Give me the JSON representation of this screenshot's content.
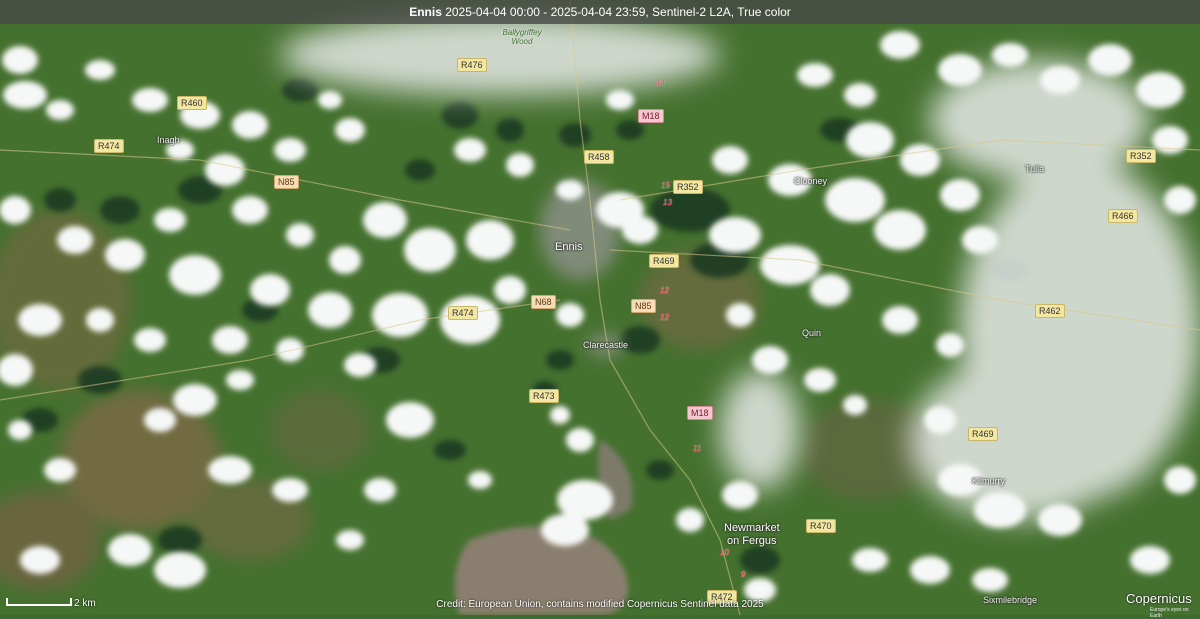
{
  "header": {
    "title_place": "Ennis",
    "title_rest": " 2025-04-04 00:00 - 2025-04-04 23:59, Sentinel-2 L2A, True color"
  },
  "roads": {
    "r476": "R476",
    "r460": "R460",
    "r474a": "R474",
    "m18a": "M18",
    "r458": "R458",
    "r352a": "R352",
    "r352b": "R352",
    "n85a": "N85",
    "r466": "R466",
    "r469a": "R469",
    "n68": "N68",
    "n85b": "N85",
    "r474b": "R474",
    "r462": "R462",
    "r473": "R473",
    "m18b": "M18",
    "r469b": "R469",
    "r470": "R470",
    "r472": "R472"
  },
  "places": {
    "ballygriffey": "Ballygriffey Wood",
    "inagh": "Inagh",
    "ennis": "Ennis",
    "clooney": "Clooney",
    "tulla": "Tulla",
    "clarecastle": "Clarecastle",
    "quin": "Quin",
    "kilmurry": "Kilmurry",
    "newmarket1": "Newmarket",
    "newmarket2": "on Fergus",
    "sixmilebridge": "Sixmilebridge"
  },
  "junctions": {
    "j14": "14",
    "j15": "15",
    "j13": "13",
    "j12": "12",
    "j12b": "12",
    "j11": "11",
    "j10": "10",
    "j9": "9"
  },
  "footer": {
    "scale": "2 km",
    "credit": "Credit: European Union, contains modified Copernicus Sentinel data 2025",
    "logo": "Copernicus",
    "logo_sub": "Europe's eyes on Earth"
  },
  "colors": {
    "land": "#3f6b32",
    "cloud": "#f4f6f5",
    "estuary": "#8a7f6e",
    "title_bg": "#464646"
  }
}
